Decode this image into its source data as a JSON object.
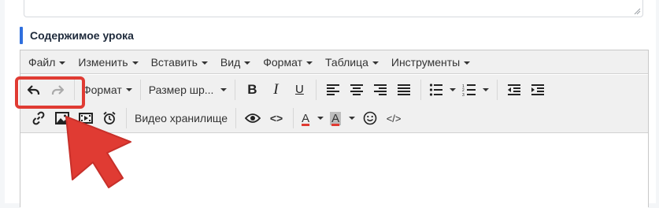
{
  "section": {
    "title": "Содержимое урока"
  },
  "menubar": {
    "items": [
      {
        "label": "Файл"
      },
      {
        "label": "Изменить"
      },
      {
        "label": "Вставить"
      },
      {
        "label": "Вид"
      },
      {
        "label": "Формат"
      },
      {
        "label": "Таблица"
      },
      {
        "label": "Инструменты"
      }
    ]
  },
  "toolbar": {
    "format_label": "Формат",
    "font_size_label": "Размер шр...",
    "video_storage_label": "Видео хранилище",
    "bold_glyph": "B",
    "italic_glyph": "I",
    "underline_glyph": "U",
    "text_color_glyph": "A",
    "bg_color_glyph": "A",
    "code_glyph": "<>",
    "source_code_glyph": "</>",
    "icons": [
      "undo-icon",
      "redo-icon",
      "align-left-icon",
      "align-center-icon",
      "align-right-icon",
      "align-justify-icon",
      "bullet-list-icon",
      "numbered-list-icon",
      "outdent-icon",
      "indent-icon",
      "link-icon",
      "image-icon",
      "video-icon",
      "alarm-clock-icon",
      "preview-eye-icon",
      "code-icon",
      "text-color-icon",
      "background-color-icon",
      "emoji-icon",
      "source-code-icon"
    ]
  },
  "colors": {
    "accent": "#2f6fde",
    "highlight": "#e03b33",
    "text_color_bar": "#e03b33",
    "bg_color_bar": "#e03b33"
  }
}
